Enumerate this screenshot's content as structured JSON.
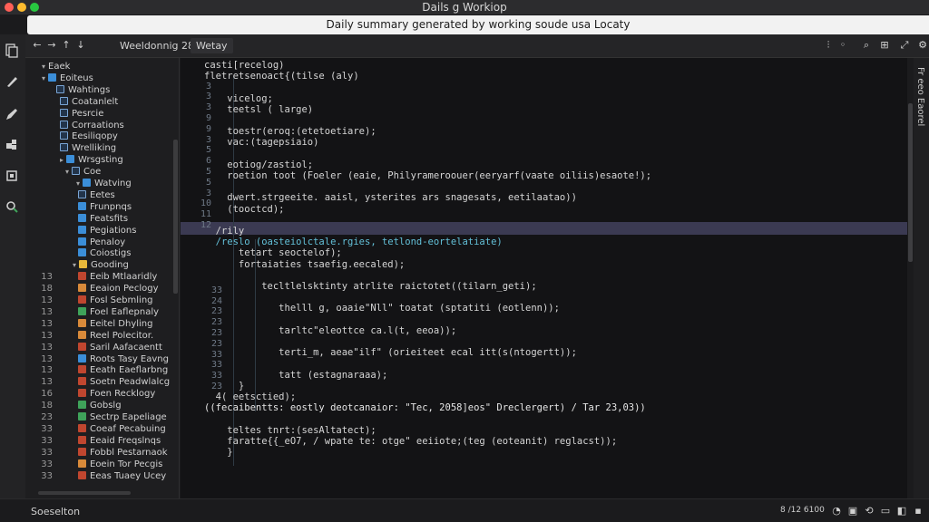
{
  "window": {
    "title": "Dails g Workiop",
    "banner": "Daily summary generated by working soude usa Locaty"
  },
  "colors": {
    "accent": "#3b8ed8",
    "highlight": "#3b3a52",
    "folder": "#e8b83a"
  },
  "toolbar": {
    "back": "←",
    "forward": "→",
    "up": "↑",
    "down": "↓",
    "tabs": [
      {
        "label": "Weeldonnig 28"
      },
      {
        "label": "Wetay"
      }
    ],
    "right_icons": [
      "split-view-icon",
      "more-icon",
      "search-icon",
      "layout-icon",
      "expand-icon",
      "settings-icon"
    ]
  },
  "activity_bar": {
    "icons": [
      "files-icon",
      "brush-icon",
      "pen-icon",
      "extensions-icon",
      "layers-icon",
      "search-icon"
    ]
  },
  "sidebar": {
    "items": [
      {
        "label": "Eaek",
        "ln": ""
      },
      {
        "label": "Eoiteus",
        "ln": ""
      },
      {
        "label": "Wahtings",
        "ln": ""
      },
      {
        "label": "Coatanlelt",
        "ln": ""
      },
      {
        "label": "Pesrcie",
        "ln": ""
      },
      {
        "label": "Corraations",
        "ln": ""
      },
      {
        "label": "Eesiliqopy",
        "ln": ""
      },
      {
        "label": "Wrelliking",
        "ln": ""
      },
      {
        "label": "Wrsgsting",
        "ln": ""
      },
      {
        "label": "Coe",
        "ln": ""
      },
      {
        "label": "Watving",
        "ln": ""
      },
      {
        "label": "Eetes",
        "ln": ""
      },
      {
        "label": "Frunpnqs",
        "ln": ""
      },
      {
        "label": "Featsfits",
        "ln": ""
      },
      {
        "label": "Pegiations",
        "ln": ""
      },
      {
        "label": "Penaloy",
        "ln": ""
      },
      {
        "label": "Coiostigs",
        "ln": ""
      },
      {
        "label": "Gooding",
        "ln": ""
      },
      {
        "label": "Eeib Mtlaaridly",
        "ln": "13"
      },
      {
        "label": "Eeaion Peclogy",
        "ln": "18"
      },
      {
        "label": "Fosl Sebmling",
        "ln": "13"
      },
      {
        "label": "Foel Eaflepnaly",
        "ln": "13"
      },
      {
        "label": "Eeitel Dhyling",
        "ln": "13"
      },
      {
        "label": "Reel Polecitor.",
        "ln": "13"
      },
      {
        "label": "Saril Aafacaentt",
        "ln": "13"
      },
      {
        "label": "Roots Tasy Eavng",
        "ln": "13"
      },
      {
        "label": "Eeath Eaeflarbng",
        "ln": "13"
      },
      {
        "label": "Soetn Peadwlalcg",
        "ln": "13"
      },
      {
        "label": "Foen Recklogy",
        "ln": "16"
      },
      {
        "label": "Gobslg",
        "ln": "18"
      },
      {
        "label": "Sectrp Eapeliage",
        "ln": "23"
      },
      {
        "label": "Coeaf Pecabuing",
        "ln": "33"
      },
      {
        "label": "Eeaid Freqslnqs",
        "ln": "33"
      },
      {
        "label": "Fobbl Pestarnaok",
        "ln": "33"
      },
      {
        "label": "Eoein Tor Pecgis",
        "ln": "33"
      },
      {
        "label": "Eeas Tuaey Ucey",
        "ln": "33"
      }
    ]
  },
  "editor": {
    "gutter": [
      "",
      "",
      "3",
      "3",
      "3",
      "9",
      "9",
      "3",
      "5",
      "6",
      "5",
      "5",
      "3",
      "10",
      "11",
      "12",
      "33",
      "24",
      "23",
      "23",
      "23",
      "23",
      "33",
      "33",
      "33",
      "23",
      "",
      "",
      "",
      "",
      ""
    ],
    "lines": [
      "casti[recelog)",
      "fletretsenoact{(tilse (aly)",
      "",
      "    vicelog;",
      "    teetsl ( large)",
      "",
      "    toestr(eroq:(etetoetiare);",
      "    vac:(tagepsiaio)",
      "",
      "    eotiog/zastiol;",
      "    roetion toot (Foeler (eaie, Philyrameroouer(eeryarf(vaate oiliis)esaote!);",
      "",
      "    dwert.strgeeite. aaisl, ysterites ars snagesats, eetilaatao))",
      "    (tooctcd);",
      "",
      "  /rily",
      "  /reslo (oasteiolctale.rgies, tetlond-eortelatiate)",
      "      tetart seoctelof);",
      "      fortaiaties tsaefig.eecaled);",
      "",
      "          tecltlelsktinty atrlite raictotet((tilarn_geti);",
      "",
      "             thelll g, oaaie\"Nll\" toatat (sptatiti (eotlenn));",
      "",
      "             tarltc\"eleottce ca.l(t, eeoa));",
      "",
      "             terti_m, aeae\"ilf\" (orieiteet ecal itt(s(ntogertt));",
      "",
      "             tatt (estagnaraaa);",
      "      }",
      "  4( eetsctied);",
      "((fecaibentts: eostly deotcanaior: \"Tec, 2058]eos\" Dreclergert) / Tar 23,03))",
      "",
      "    teltes tnrt:(sesAltatect);",
      "    faratte{{_eO7, / wpate te: otge\" eeiiote;(teg (eoteanit) reglacst));",
      "    }"
    ]
  },
  "right_panel": {
    "label": "Fr eeo Eaorel"
  },
  "statusbar": {
    "left": "Soeselton",
    "right": "8 /12 6100",
    "icons": [
      "bell-icon",
      "terminal-icon",
      "sync-icon",
      "layout-icon",
      "panel-icon",
      "close-icon"
    ]
  }
}
